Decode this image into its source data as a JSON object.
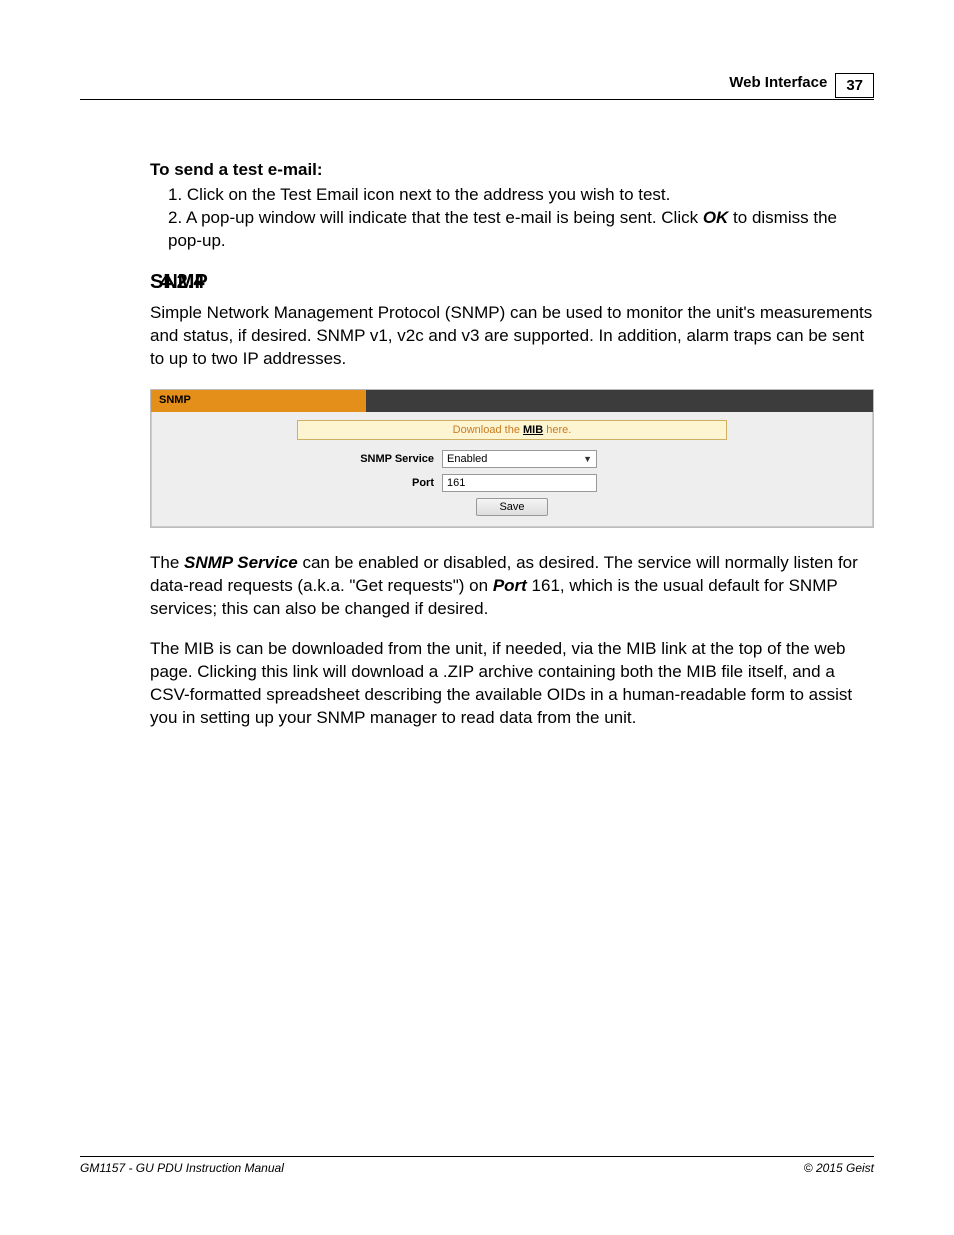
{
  "header": {
    "section": "Web Interface",
    "page": "37"
  },
  "email": {
    "heading": "To send a test e-mail:",
    "step1": "1. Click on the Test Email icon next to the address you wish to test.",
    "step2a": "2. A pop-up window will indicate that the test e-mail is being sent.  Click ",
    "step2b_bold": "OK",
    "step2c": " to dismiss the pop-up."
  },
  "section": {
    "num": "4.2.4",
    "title": "SNMP"
  },
  "intro": "Simple Network Management Protocol (SNMP) can be used to monitor the unit's measurements and status, if desired.  SNMP v1, v2c and v3 are supported.  In addition, alarm traps can be sent to up to two IP addresses.",
  "panel": {
    "tab": "SNMP",
    "download_pre": "Download the ",
    "download_mib": "MIB",
    "download_post": " here.",
    "service_label": "SNMP Service",
    "service_value": "Enabled",
    "port_label": "Port",
    "port_value": "161",
    "save": "Save"
  },
  "para2": {
    "a": "The ",
    "b_bold": "SNMP Service",
    "c": " can be enabled or disabled, as desired.  The service will normally listen for data-read requests (a.k.a. \"Get requests\") on ",
    "d_bold": "Port",
    "e": " 161, which is the usual default for SNMP services; this can also be changed if desired."
  },
  "para3": "The MIB is can be downloaded from the unit, if needed, via the MIB link at the top of the web page.  Clicking this link will download a .ZIP archive containing both the MIB file itself, and a CSV-formatted spreadsheet describing the available OIDs in a human-readable form to assist you in setting up your SNMP manager to read data from the unit.",
  "footer": {
    "left": "GM1157 - GU PDU Instruction Manual",
    "right": "© 2015 Geist"
  }
}
